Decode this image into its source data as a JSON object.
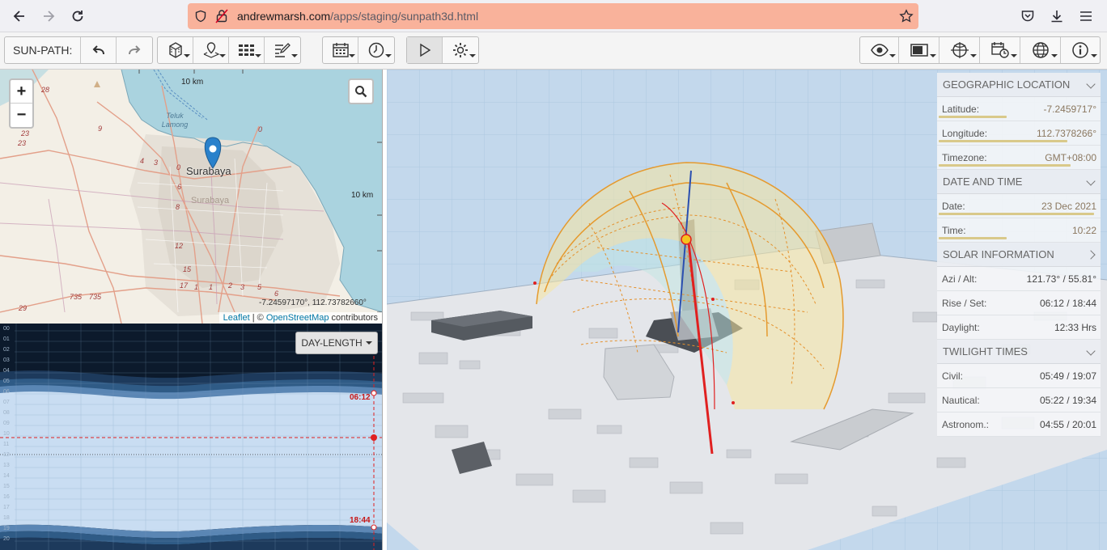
{
  "browser": {
    "url_host": "andrewmarsh.com",
    "url_path": "/apps/staging/sunpath3d.html"
  },
  "toolbar": {
    "app_label": "SUN-PATH:"
  },
  "map": {
    "city_label": "Surabaya",
    "city_label_faded": "Surabaya",
    "place_label": "Teluk Lamong",
    "scale_top": "10 km",
    "scale_right": "10 km",
    "coords": "-7.24597170°, 112.73782660°",
    "attrib_leaflet": "Leaflet",
    "attrib_sep": " | © ",
    "attrib_osm": "OpenStreetMap",
    "attrib_tail": " contributors",
    "road_numbers": [
      "28",
      "23",
      "23",
      "9",
      "4",
      "3",
      "0",
      "0",
      "6",
      "8",
      "12",
      "15",
      "17",
      "1",
      "1",
      "2",
      "3",
      "5",
      "6",
      "735",
      "735",
      "29"
    ]
  },
  "chart": {
    "mode_button": "DAY-LENGTH",
    "hour_labels": [
      "00",
      "01",
      "02",
      "03",
      "04",
      "05",
      "06",
      "07",
      "08",
      "09",
      "10",
      "11",
      "12",
      "13",
      "14",
      "15",
      "16",
      "17",
      "18",
      "19",
      "20"
    ],
    "sunrise_label": "06:12",
    "sunset_label": "18:44"
  },
  "info": {
    "geo": {
      "title": "GEOGRAPHIC LOCATION",
      "latitude_label": "Latitude:",
      "latitude_value": "-7.2459717°",
      "latitude_fill": 0.43,
      "longitude_label": "Longitude:",
      "longitude_value": "112.7378266°",
      "longitude_fill": 0.81,
      "timezone_label": "Timezone:",
      "timezone_value": "GMT+08:00",
      "timezone_fill": 0.83
    },
    "datetime": {
      "title": "DATE AND TIME",
      "date_label": "Date:",
      "date_value": "23 Dec 2021",
      "date_fill": 0.98,
      "time_label": "Time:",
      "time_value": "10:22",
      "time_fill": 0.43
    },
    "solar": {
      "title": "SOLAR INFORMATION",
      "azi_label": "Azi / Alt:",
      "azi_value": "121.73° / 55.81°",
      "rise_label": "Rise / Set:",
      "rise_value": "06:12 / 18:44",
      "daylight_label": "Daylight:",
      "daylight_value": "12:33 Hrs"
    },
    "twilight": {
      "title": "TWILIGHT TIMES",
      "civil_label": "Civil:",
      "civil_value": "05:49 / 19:07",
      "nautical_label": "Nautical:",
      "nautical_value": "05:22 / 19:34",
      "astro_label": "Astronom.:",
      "astro_value": "04:55 / 20:01"
    }
  },
  "colors": {
    "url_bar": "#f9b29b",
    "sky": "#c3d8ec",
    "sunpath_fill": "#f5e6a0",
    "sunpath_line": "#e59a2e",
    "sun_ray": "#e02020",
    "chart_bg": "#0c1a2c",
    "chart_day": "#c9ddf2"
  }
}
